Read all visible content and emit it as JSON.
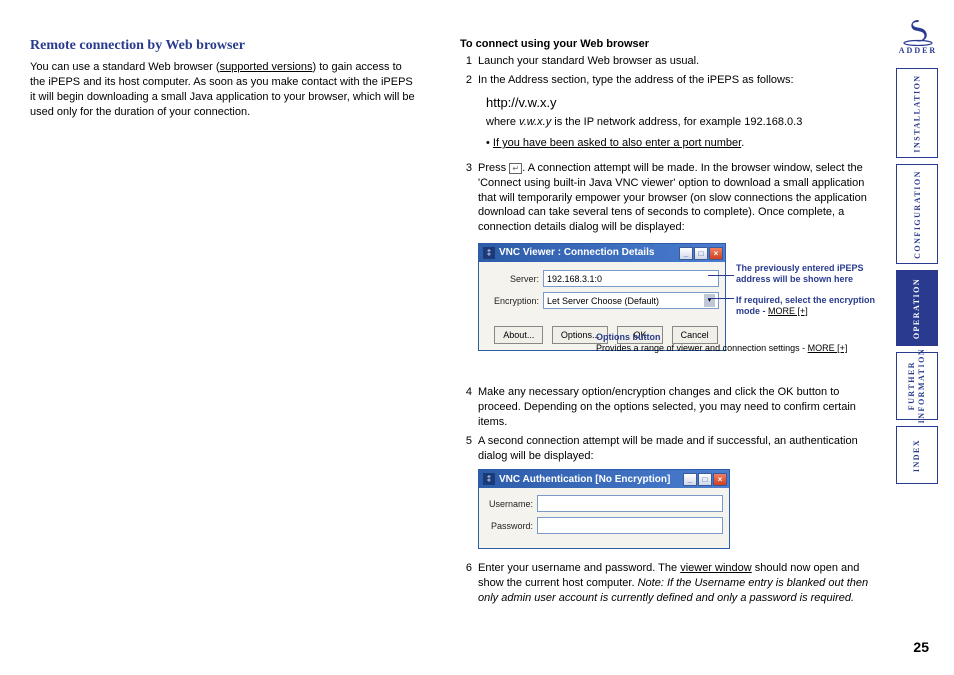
{
  "heading": "Remote connection by Web browser",
  "intro_p1a": "You can use a standard Web browser (",
  "intro_link1": "supported versions",
  "intro_p1b": ") to gain access to the iPEPS and its host computer. As soon as you make contact with the iPEPS it will begin downloading a small Java application to your browser, which will be used only for the duration of your connection.",
  "steps_heading": "To connect using your Web browser",
  "step1": "Launch your standard Web browser as usual.",
  "step2": "In the Address section, type the address of the iPEPS as follows:",
  "address_example": "http://v.w.x.y",
  "where_a": "where ",
  "where_ip": "v.w.x.y",
  "where_b": " is the IP network address, for example 192.168.0.3",
  "bullet_link": "If you have been asked to also enter a port number",
  "step3a": "Press ",
  "step3b": ". A connection attempt will be made. In the browser window, select the 'Connect using built-in Java VNC viewer' option to download a small application that will temporarily empower your browser (on slow connections the application download can take several tens of seconds to complete). Once complete, a connection details dialog will be displayed:",
  "step4": "Make any necessary option/encryption changes and click the OK button to proceed. Depending on the options selected, you may need to confirm certain items.",
  "step5": "A second connection attempt will be made and if successful, an authentication dialog will be displayed:",
  "step6a": "Enter your username and password. The ",
  "step6_link": "viewer window",
  "step6b": " should now open and show the current host computer. ",
  "step6_note": "Note: If the Username entry is blanked out then only admin user account is currently defined and only a password is required.",
  "dlg1": {
    "title": "VNC Viewer : Connection Details",
    "server_label": "Server:",
    "server_value": "192.168.3.1:0",
    "enc_label": "Encryption:",
    "enc_value": "Let Server Choose (Default)",
    "btn_about": "About...",
    "btn_options": "Options...",
    "btn_ok": "OK",
    "btn_cancel": "Cancel"
  },
  "callout1": "The previously entered iPEPS address will be shown here",
  "callout2a": "If required, select the encryption mode - ",
  "callout_more": "MORE [+]",
  "callout3_title": "Options button",
  "callout3_desc": "Provides a range of viewer and connection settings - ",
  "dlg2": {
    "title": "VNC Authentication [No Encryption]",
    "user_label": "Username:",
    "pass_label": "Password:"
  },
  "sidebar": {
    "installation": "INSTALLATION",
    "configuration": "CONFIGURATION",
    "operation": "OPERATION",
    "further1": "FURTHER",
    "further2": "INFORMATION",
    "index": "INDEX"
  },
  "logo_text": "ADDER",
  "pagenum": "25"
}
